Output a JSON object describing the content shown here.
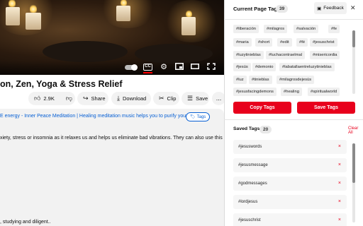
{
  "video": {
    "title": "on, Zen, Yoga & Stress Relief",
    "cc_label": "CC"
  },
  "actions": {
    "likes": "2.9K",
    "share": "Share",
    "download": "Download",
    "clip": "Clip",
    "save": "Save",
    "more": "..."
  },
  "description": {
    "line1": "E energy - Inner Peace Meditation | Healing meditation music helps you to purify your body",
    "tags_chip": "Tags",
    "line2": "xiety, stress or insomnia as it relaxes us and helps us eliminate bad vibrations. They can also use this music",
    "line3": ", studying and diligent.."
  },
  "panel": {
    "current_tags_title": "Current Page Tags",
    "current_tags_count": "39",
    "feedback_label": "Feedback",
    "close_label": "✕",
    "tags": [
      "#liberación",
      "#milagros",
      "#salvación",
      "#fe",
      "#maria",
      "#short",
      "#edit",
      "#fé",
      "#jesuschrist",
      "#luzytinieblas",
      "#luchacontraelmal",
      "#misericordia",
      "#jesús",
      "#demonio",
      "#labatallaentreluzytinieblas",
      "#luz",
      "#tinieblas",
      "#milagrosdejesús",
      "#jesusfacingdemons",
      "#healing",
      "#spiritualworld"
    ],
    "copy_tags": "Copy Tags",
    "save_tags": "Save Tags",
    "saved_tags_title": "Saved Tags",
    "saved_tags_count": "20",
    "clear_all": "Clear All",
    "saved": [
      "#jesuswords",
      "#jesusmessage",
      "#godmessages",
      "#lordjesus",
      "#jesuschrist"
    ],
    "remove_label": "×"
  },
  "colors": {
    "accent": "#e8001c",
    "link": "#065fd4"
  }
}
